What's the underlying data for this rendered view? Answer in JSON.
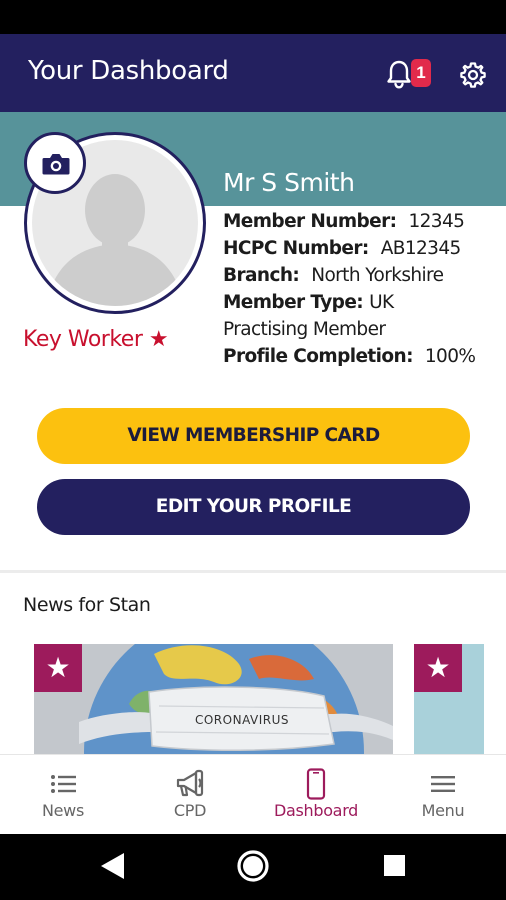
{
  "header": {
    "title": "Your Dashboard",
    "notification_count": "1",
    "icons": [
      "bell-icon",
      "gear-icon"
    ]
  },
  "profile": {
    "name": "Mr S Smith",
    "key_worker": "Key Worker ★",
    "details": {
      "member_number_label": "Member Number:",
      "member_number": "12345",
      "hcpc_label": "HCPC Number:",
      "hcpc": "AB12345",
      "branch_label": "Branch:",
      "branch": "North Yorkshire",
      "member_type_label": "Member Type:",
      "member_type": "UK",
      "member_type_cont": "Practising Member",
      "completion_label": "Profile Completion:",
      "completion": "100%"
    }
  },
  "actions": {
    "view_card": "VIEW MEMBERSHIP CARD",
    "edit_profile": "EDIT YOUR PROFILE"
  },
  "news": {
    "heading": "News for Stan",
    "card_1_mask_text": "CORONAVIRUS",
    "star": "★"
  },
  "nav": {
    "items": [
      {
        "label": "News",
        "icon": "list-icon"
      },
      {
        "label": "CPD",
        "icon": "megaphone-icon"
      },
      {
        "label": "Dashboard",
        "icon": "phone-icon"
      },
      {
        "label": "Menu",
        "icon": "hamburger-icon"
      }
    ],
    "active": "Dashboard"
  },
  "colors": {
    "navy": "#23205f",
    "teal": "#57939a",
    "yellow": "#fcc10f",
    "accent": "#9d1b5c",
    "key_worker_red": "#c8102e",
    "badge_red": "#e12a4b"
  }
}
